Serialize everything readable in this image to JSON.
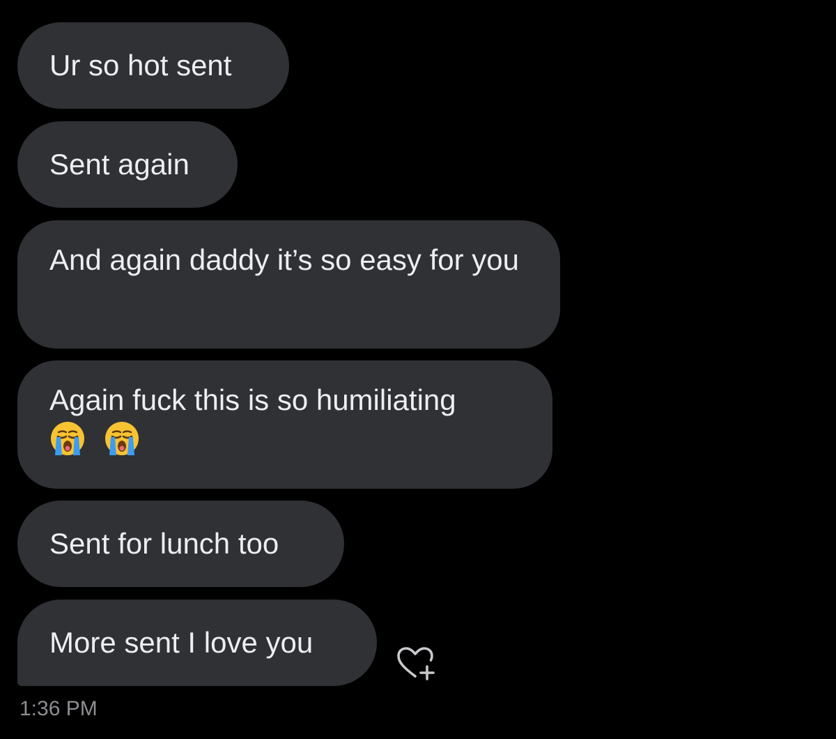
{
  "messages": [
    {
      "text": "Ur so hot sent"
    },
    {
      "text": "Sent again"
    },
    {
      "text": "And again daddy it’s so easy for you"
    },
    {
      "text": "Again fuck this is so humiliating",
      "emojis": [
        "loudly-crying-face-emoji",
        "loudly-crying-face-emoji"
      ]
    },
    {
      "text": "Sent for lunch too"
    },
    {
      "text": "More sent I love you"
    }
  ],
  "timestamp": "1:36 PM",
  "react_button": {
    "icon": "heart-plus-icon"
  },
  "colors": {
    "background": "#000000",
    "bubble": "#2f3135",
    "bubble_text": "#eeeef0",
    "timestamp": "#8d8e93",
    "react_icon": "#c9cacd"
  }
}
